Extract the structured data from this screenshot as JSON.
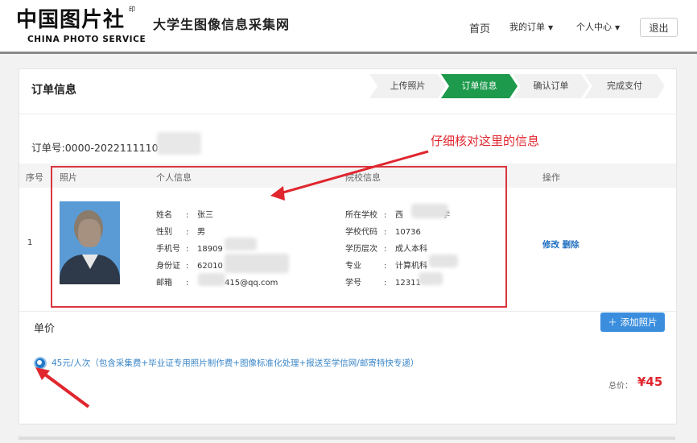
{
  "header": {
    "logo_cn": "中国图片社",
    "logo_seal": "印",
    "logo_en": "CHINA PHOTO SERVICE",
    "site_subtitle": "大学生图像信息采集网",
    "nav_home": "首页",
    "nav_orders": "我的订单",
    "nav_center": "个人中心",
    "logout": "退出",
    "caret_icon": "caret-down-icon"
  },
  "order": {
    "title": "订单信息",
    "steps": [
      "上传照片",
      "订单信息",
      "确认订单",
      "完成支付"
    ],
    "active_step": 2,
    "active_color": "#1d9a4c",
    "order_no": "订单号:0000-2022111110",
    "columns": [
      "序号",
      "照片",
      "个人信息",
      "院校信息",
      "操作"
    ],
    "row": {
      "index": "1",
      "personal": [
        {
          "label": "姓名",
          "value": "张三"
        },
        {
          "label": "性别",
          "value": "男"
        },
        {
          "label": "手机号",
          "value": "18909"
        },
        {
          "label": "身份证",
          "value": "62010"
        },
        {
          "label": "邮箱",
          "value": "415@qq.com"
        }
      ],
      "school": [
        {
          "label": "所在学校",
          "value": "西"
        },
        {
          "label": "学校代码",
          "value": "10736"
        },
        {
          "label": "学历层次",
          "value": "成人本科"
        },
        {
          "label": "专业",
          "value": "计算机科"
        },
        {
          "label": "学号",
          "value": "12311"
        }
      ],
      "school_suffix": "学",
      "action_edit": "修改",
      "action_delete": "删除"
    },
    "annotation": "仔细核对这里的信息",
    "annotation_color": "#e0262e"
  },
  "price": {
    "title": "单价",
    "add_photo": "添加照片",
    "add_icon": "plus-icon",
    "option": "45元/人次（包含采集费+毕业证专用照片制作费+图像标准化处理+报送至学信网/邮寄特快专递）",
    "total_label": "总价：",
    "total_value": "¥45"
  }
}
